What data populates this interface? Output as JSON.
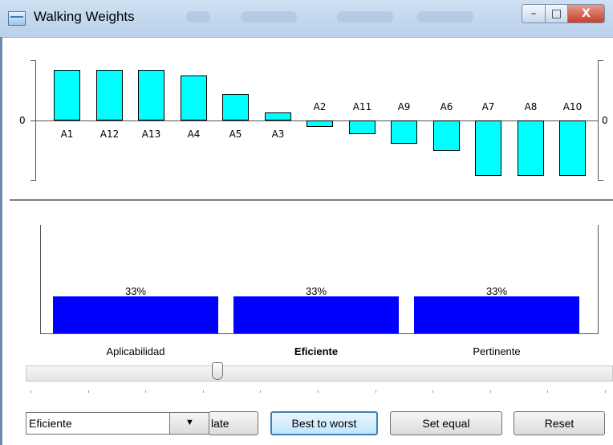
{
  "window": {
    "title": "Walking Weights",
    "buttons": {
      "minimize": "–",
      "maximize": "□",
      "close": "X"
    }
  },
  "alternatives_chart": {
    "zero_label_left": "0",
    "zero_label_right": "0",
    "bar_color": "#00ffff",
    "bars": [
      {
        "label": "A1",
        "value": 0.95
      },
      {
        "label": "A12",
        "value": 0.95
      },
      {
        "label": "A13",
        "value": 0.95
      },
      {
        "label": "A4",
        "value": 0.85
      },
      {
        "label": "A5",
        "value": 0.5
      },
      {
        "label": "A3",
        "value": 0.15
      },
      {
        "label": "A2",
        "value": -0.12
      },
      {
        "label": "A11",
        "value": -0.25
      },
      {
        "label": "A9",
        "value": -0.42
      },
      {
        "label": "A6",
        "value": -0.55
      },
      {
        "label": "A7",
        "value": -1.0
      },
      {
        "label": "A8",
        "value": -1.0
      },
      {
        "label": "A10",
        "value": -1.0
      }
    ]
  },
  "criteria_chart": {
    "bar_color": "#0000ff",
    "criteria": [
      {
        "name": "Aplicabilidad",
        "percent_label": "33%",
        "weight": 0.33,
        "selected": false
      },
      {
        "name": "Eficiente",
        "percent_label": "33%",
        "weight": 0.33,
        "selected": true
      },
      {
        "name": "Pertinente",
        "percent_label": "33%",
        "weight": 0.33,
        "selected": false
      }
    ]
  },
  "slider": {
    "value_fraction": 0.33,
    "tick_count": 11
  },
  "controls": {
    "criterion_select": {
      "value": "Eficiente"
    },
    "rotate_button": "late",
    "best_to_worst_button": "Best to worst",
    "set_equal_button": "Set equal",
    "reset_button": "Reset"
  }
}
